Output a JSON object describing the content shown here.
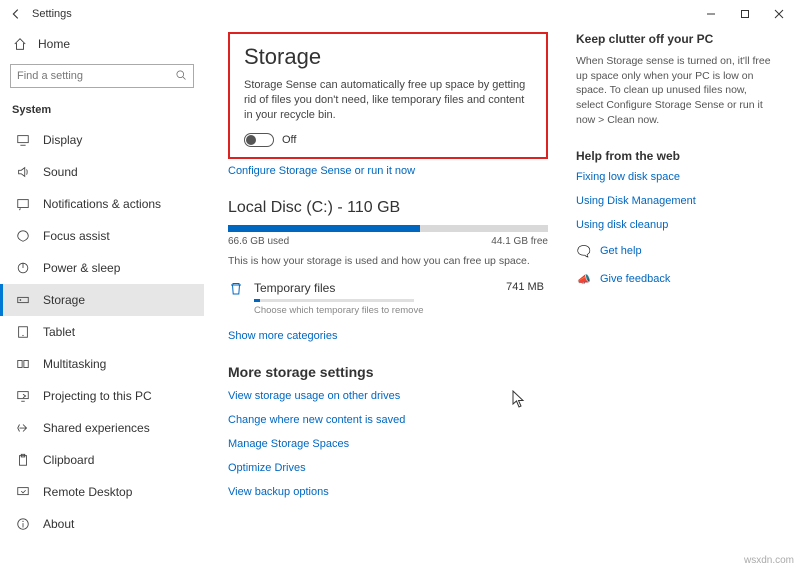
{
  "window": {
    "title": "Settings"
  },
  "sidebar": {
    "home": "Home",
    "search_placeholder": "Find a setting",
    "section": "System",
    "items": [
      {
        "label": "Display",
        "icon": "display-icon"
      },
      {
        "label": "Sound",
        "icon": "sound-icon"
      },
      {
        "label": "Notifications & actions",
        "icon": "notifications-icon"
      },
      {
        "label": "Focus assist",
        "icon": "focus-icon"
      },
      {
        "label": "Power & sleep",
        "icon": "power-icon"
      },
      {
        "label": "Storage",
        "icon": "storage-icon",
        "selected": true
      },
      {
        "label": "Tablet",
        "icon": "tablet-icon"
      },
      {
        "label": "Multitasking",
        "icon": "multitasking-icon"
      },
      {
        "label": "Projecting to this PC",
        "icon": "projecting-icon"
      },
      {
        "label": "Shared experiences",
        "icon": "shared-icon"
      },
      {
        "label": "Clipboard",
        "icon": "clipboard-icon"
      },
      {
        "label": "Remote Desktop",
        "icon": "remote-icon"
      },
      {
        "label": "About",
        "icon": "about-icon"
      }
    ]
  },
  "storage": {
    "heading": "Storage",
    "description": "Storage Sense can automatically free up space by getting rid of files you don't need, like temporary files and content in your recycle bin.",
    "toggle_state": "Off",
    "configure_link": "Configure Storage Sense or run it now",
    "disk_heading": "Local Disc (C:) - 110 GB",
    "used_label": "66.6 GB used",
    "free_label": "44.1 GB free",
    "used_pct": 60,
    "usage_hint": "This is how your storage is used and how you can free up space.",
    "category": {
      "label": "Temporary files",
      "size": "741 MB",
      "hint": "Choose which temporary files to remove"
    },
    "show_more": "Show more categories",
    "more_heading": "More storage settings",
    "more_links": [
      "View storage usage on other drives",
      "Change where new content is saved",
      "Manage Storage Spaces",
      "Optimize Drives",
      "View backup options"
    ]
  },
  "right": {
    "keep_heading": "Keep clutter off your PC",
    "keep_text": "When Storage sense is turned on, it'll free up space only when your PC is low on space. To clean up unused files now, select Configure Storage Sense or run it now > Clean now.",
    "help_heading": "Help from the web",
    "help_links": [
      "Fixing low disk space",
      "Using Disk Management",
      "Using disk cleanup"
    ],
    "get_help": "Get help",
    "feedback": "Give feedback"
  },
  "watermark": "wsxdn.com"
}
